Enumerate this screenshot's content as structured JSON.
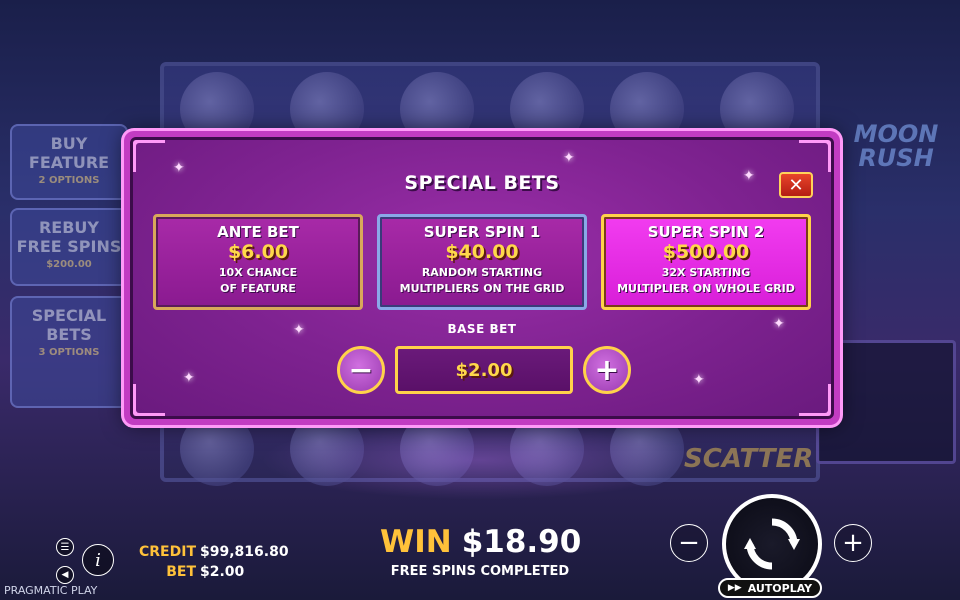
{
  "background": {
    "side_panels": [
      {
        "title": "BUY\nFEATURE",
        "sub": "2 OPTIONS"
      },
      {
        "title": "REBUY\nFREE SPINS",
        "sub": "$200.00"
      },
      {
        "title": "SPECIAL\nBETS",
        "sub": "3 OPTIONS"
      }
    ],
    "logo": "MOON\nRUSH",
    "scatter_text": "SCATTER"
  },
  "modal": {
    "title": "SPECIAL BETS",
    "close_label": "✕",
    "cards": [
      {
        "name": "ANTE BET",
        "price": "$6.00",
        "desc_line1": "10X CHANCE",
        "desc_line2": "OF FEATURE"
      },
      {
        "name": "SUPER SPIN 1",
        "price": "$40.00",
        "desc_line1": "RANDOM STARTING",
        "desc_line2": "MULTIPLIERS ON THE GRID"
      },
      {
        "name": "SUPER SPIN 2",
        "price": "$500.00",
        "desc_line1": "32X STARTING",
        "desc_line2": "MULTIPLIER ON WHOLE GRID"
      }
    ],
    "base_bet_label": "BASE BET",
    "base_bet_value": "$2.00",
    "minus_label": "−",
    "plus_label": "+"
  },
  "hud": {
    "credit_label": "CREDIT",
    "credit_value": "$99,816.80",
    "bet_label": "BET",
    "bet_value": "$2.00",
    "win_label": "WIN",
    "win_amount": "$18.90",
    "win_status": "FREE SPINS COMPLETED",
    "autoplay_label": "AUTOPLAY",
    "brand": "PRAGMATIC PLAY",
    "minus_label": "−",
    "plus_label": "+"
  },
  "colors": {
    "accent_gold": "#ffd84a",
    "modal_pink": "#c23cc2",
    "win_label": "#ffc23a"
  },
  "icons": [
    "menu-icon",
    "sound-icon",
    "info-icon",
    "close-icon",
    "spin-arrows-icon",
    "autoplay-icon"
  ]
}
